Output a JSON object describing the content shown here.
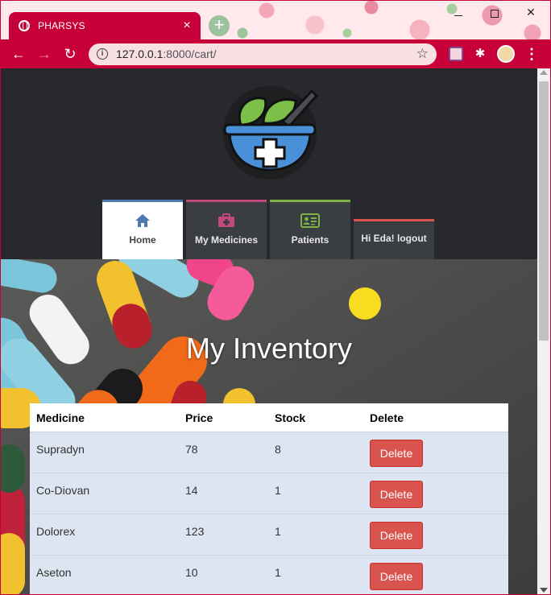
{
  "browser": {
    "tab_title": "PHARSYS",
    "tab_close": "×",
    "new_tab": "+",
    "url_host": "127.0.0.1",
    "url_path": ":8000/cart/",
    "star": "☆"
  },
  "nav": {
    "items": [
      {
        "label": "Home",
        "icon": "home-icon"
      },
      {
        "label": "My Medicines",
        "icon": "medkit-icon"
      },
      {
        "label": "Patients",
        "icon": "id-card-icon"
      },
      {
        "label": "Hi Eda! logout",
        "icon": ""
      }
    ]
  },
  "hero": {
    "title": "My Inventory"
  },
  "table": {
    "headers": [
      "Medicine",
      "Price",
      "Stock",
      "Delete"
    ],
    "rows": [
      {
        "medicine": "Supradyn",
        "price": "78",
        "stock": "8",
        "action": "Delete"
      },
      {
        "medicine": "Co-Diovan",
        "price": "14",
        "stock": "1",
        "action": "Delete"
      },
      {
        "medicine": "Dolorex",
        "price": "123",
        "stock": "1",
        "action": "Delete"
      },
      {
        "medicine": "Aseton",
        "price": "10",
        "stock": "1",
        "action": "Delete"
      }
    ]
  },
  "colors": {
    "browser_accent": "#c8003a",
    "header_bg": "#27292c",
    "delete_button": "#d9534f",
    "row_bg": "#dde5f2"
  }
}
